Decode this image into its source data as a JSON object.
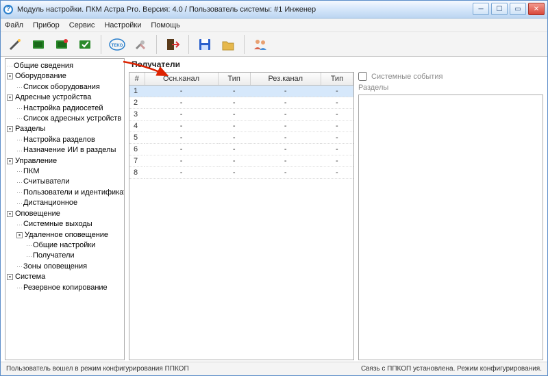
{
  "window": {
    "title": "Модуль настройки. ПКМ Астра Pro. Версия: 4.0 / Пользователь системы: #1 Инженер"
  },
  "menu": {
    "file": "Файл",
    "device": "Прибор",
    "service": "Сервис",
    "settings": "Настройки",
    "help": "Помощь"
  },
  "tree": {
    "n0": "Общие сведения",
    "n1": "Оборудование",
    "n1_1": "Список оборудования",
    "n2": "Адресные устройства",
    "n2_1": "Настройка радиосетей",
    "n2_2": "Список адресных устройств",
    "n3": "Разделы",
    "n3_1": "Настройка разделов",
    "n3_2": "Назначение ИИ в разделы",
    "n4": "Управление",
    "n4_1": "ПКМ",
    "n4_2": "Считыватели",
    "n4_3": "Пользователи и идентификаторы",
    "n4_4": "Дистанционное",
    "n5": "Оповещение",
    "n5_1": "Системные выходы",
    "n5_2": "Удаленное оповещение",
    "n5_2_1": "Общие настройки",
    "n5_2_2": "Получатели",
    "n5_3": "Зоны оповещения",
    "n6": "Система",
    "n6_1": "Резервное копирование"
  },
  "main": {
    "title": "Получатели"
  },
  "table": {
    "headers": {
      "num": "#",
      "main_channel": "Осн.канал",
      "type1": "Тип",
      "res_channel": "Рез.канал",
      "type2": "Тип"
    },
    "rows": [
      {
        "n": "1",
        "a": "-",
        "b": "-",
        "c": "-",
        "d": "-"
      },
      {
        "n": "2",
        "a": "-",
        "b": "-",
        "c": "-",
        "d": "-"
      },
      {
        "n": "3",
        "a": "-",
        "b": "-",
        "c": "-",
        "d": "-"
      },
      {
        "n": "4",
        "a": "-",
        "b": "-",
        "c": "-",
        "d": "-"
      },
      {
        "n": "5",
        "a": "-",
        "b": "-",
        "c": "-",
        "d": "-"
      },
      {
        "n": "6",
        "a": "-",
        "b": "-",
        "c": "-",
        "d": "-"
      },
      {
        "n": "7",
        "a": "-",
        "b": "-",
        "c": "-",
        "d": "-"
      },
      {
        "n": "8",
        "a": "-",
        "b": "-",
        "c": "-",
        "d": "-"
      }
    ]
  },
  "right": {
    "system_events": "Системные события",
    "sections": "Разделы"
  },
  "status": {
    "left": "Пользователь вошел в режим конфигурирования ППКОП",
    "right": "Связь с ППКОП установлена. Режим конфигурирования."
  }
}
